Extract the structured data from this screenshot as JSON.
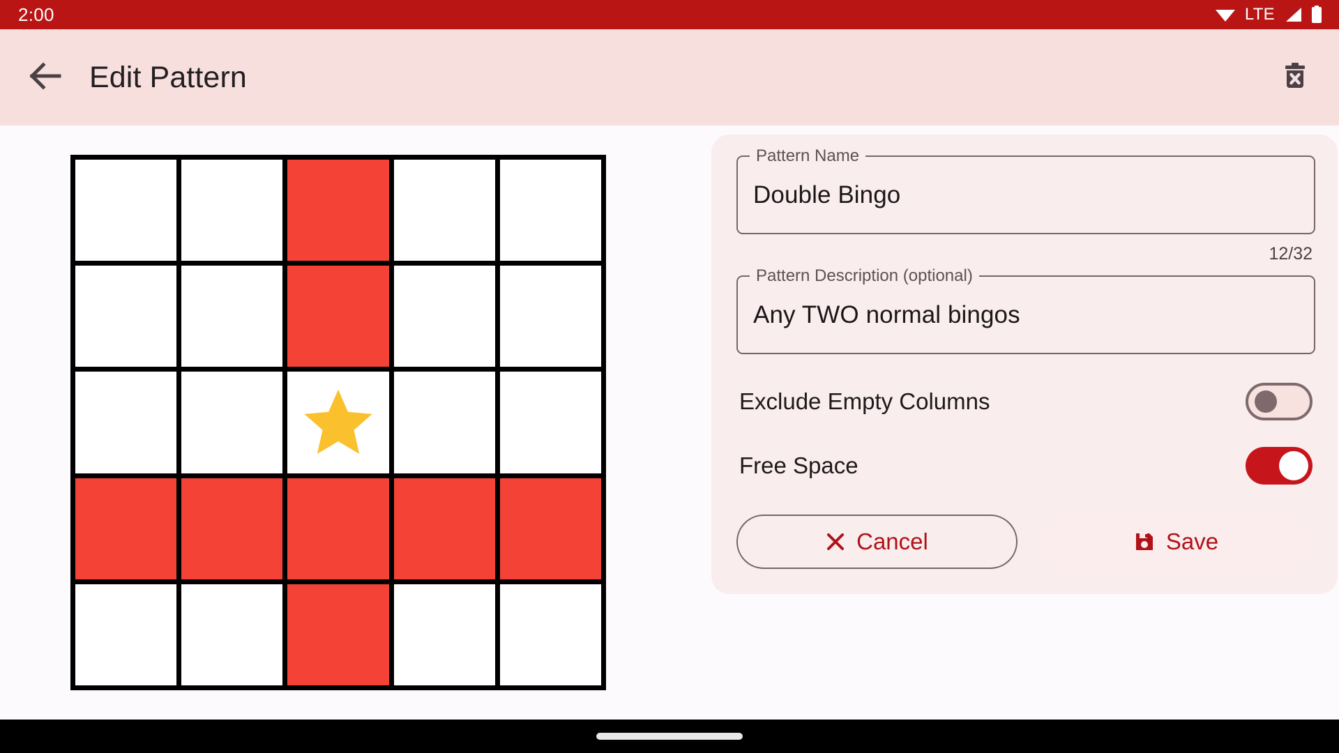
{
  "status_bar": {
    "clock": "2:00",
    "network_label": "LTE",
    "icons": [
      "wifi-icon",
      "lte-label",
      "cellular-signal-icon",
      "battery-icon"
    ],
    "background_color": "#BA1515",
    "foreground_color": "#FFFFFF"
  },
  "app_bar": {
    "back_icon": "arrow-back-icon",
    "title": "Edit Pattern",
    "delete_icon": "delete-forever-icon",
    "background_color": "#F6DFDD",
    "title_color": "#231E21"
  },
  "pattern_grid": {
    "rows": 5,
    "columns": 5,
    "selected_color": "#F44336",
    "empty_color": "#FFFFFF",
    "border_color": "#000000",
    "free_space_icon": "star-icon",
    "free_space_color": "#FBC02D",
    "free_space_cell": {
      "row": 2,
      "col": 2
    },
    "cells": [
      [
        false,
        false,
        true,
        false,
        false
      ],
      [
        false,
        false,
        true,
        false,
        false
      ],
      [
        false,
        false,
        false,
        false,
        false
      ],
      [
        true,
        true,
        true,
        true,
        true
      ],
      [
        false,
        false,
        true,
        false,
        false
      ]
    ]
  },
  "form": {
    "name_field": {
      "label": "Pattern Name",
      "value": "Double Bingo",
      "placeholder": "Pattern Name"
    },
    "char_counter": "12/32",
    "description_field": {
      "label": "Pattern Description (optional)",
      "value": "Any TWO normal bingos",
      "placeholder": "Pattern Description (optional)"
    },
    "toggles": [
      {
        "label": "Exclude Empty Columns",
        "state": "off"
      },
      {
        "label": "Free Space",
        "state": "on"
      }
    ],
    "buttons": {
      "cancel": {
        "label": "Cancel",
        "icon": "close-x-icon"
      },
      "save": {
        "label": "Save",
        "icon": "floppy-disk-save-icon"
      }
    },
    "card_color": "#F9EDEE",
    "accent_color": "#B01217",
    "toggle_on_color": "#C6151B"
  },
  "nav_bar": {
    "gesture_pill": "home-gesture-pill",
    "background_color": "#000000"
  },
  "page": {
    "background_color": "#FCFAFD"
  }
}
